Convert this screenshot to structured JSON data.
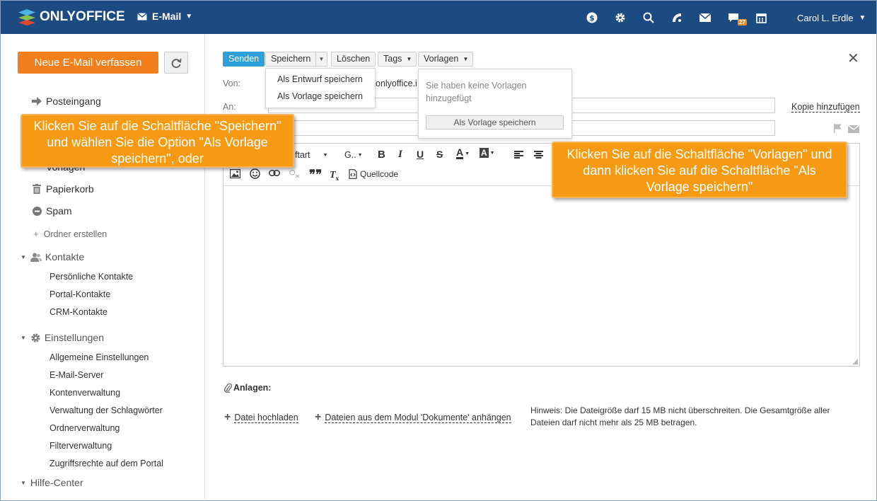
{
  "header": {
    "brand": "ONLYOFFICE",
    "module": "E-Mail",
    "user": "Carol L. Erdle",
    "chat_badge": "27",
    "icons": [
      "dollar-icon",
      "gear-icon",
      "search-icon",
      "feed-icon",
      "mail-icon",
      "chat-icon",
      "calendar-icon"
    ]
  },
  "sidebar": {
    "compose": "Neue E-Mail verfassen",
    "inbox": "Posteingang",
    "hidden_item": "Vorlagen",
    "trash": "Papierkorb",
    "spam": "Spam",
    "create_folder": "Ordner erstellen",
    "contacts": {
      "title": "Kontakte",
      "items": [
        "Persönliche Kontakte",
        "Portal-Kontakte",
        "CRM-Kontakte"
      ]
    },
    "settings": {
      "title": "Einstellungen",
      "items": [
        "Allgemeine Einstellungen",
        "E-Mail-Server",
        "Kontenverwaltung",
        "Verwaltung der Schlagwörter",
        "Ordnerverwaltung",
        "Filterverwaltung",
        "Zugriffsrechte auf dem Portal"
      ]
    },
    "help": "Hilfe-Center"
  },
  "toolbar": {
    "send": "Senden",
    "save": "Speichern",
    "delete": "Löschen",
    "tags": "Tags",
    "templates": "Vorlagen"
  },
  "save_menu": {
    "items": [
      "Als Entwurf speichern",
      "Als Vorlage speichern"
    ]
  },
  "templates_menu": {
    "empty_text": "Sie haben keine Vorlagen hinzugefügt",
    "button": "Als Vorlage speichern"
  },
  "form": {
    "from_label": "Von:",
    "from_value": "onlyoffice.i",
    "to_label": "An:",
    "copy_link": "Kopie hinzufügen"
  },
  "editor": {
    "font_family": "riftart",
    "font_size": "G..",
    "source": "Quellcode"
  },
  "attachments": {
    "label": "Anlagen:",
    "upload": "Datei hochladen",
    "from_documents": "Dateien aus dem Modul 'Dokumente' anhängen",
    "hint": "Hinweis: Die Dateigröße darf 15 MB nicht überschreiten. Die Gesamtgröße aller Dateien darf nicht mehr als 25 MB betragen."
  },
  "callouts": {
    "left": "Klicken Sie auf die Schaltfläche \"Speichern\" und wählen Sie die Option \"Als Vorlage speichern\", oder",
    "right": "Klicken Sie auf die Schaltfläche \"Vorlagen\" und dann klicken Sie auf die Schaltfläche \"Als Vorlage speichern\""
  },
  "colors": {
    "header_bg": "#1c4b82",
    "compose_bg": "#f27f1b",
    "send_bg": "#2d9fd9",
    "callout_bg": "#f59a12"
  }
}
